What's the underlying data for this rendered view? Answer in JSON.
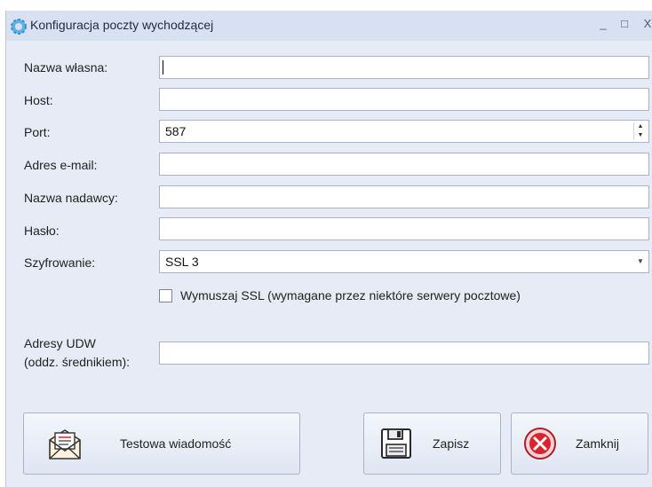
{
  "window": {
    "title": "Konfiguracja poczty wychodzącej",
    "minimize": "_",
    "maximize": "□",
    "close": "X"
  },
  "form": {
    "name_label": "Nazwa własna:",
    "name_value": "",
    "host_label": "Host:",
    "host_value": "",
    "port_label": "Port:",
    "port_value": "587",
    "email_label": "Adres e-mail:",
    "email_value": "",
    "sender_label": "Nazwa nadawcy:",
    "sender_value": "",
    "password_label": "Hasło:",
    "password_value": "",
    "encryption_label": "Szyfrowanie:",
    "encryption_value": "SSL 3",
    "force_ssl_label": "Wymuszaj SSL (wymagane przez niektóre serwery pocztowe)",
    "force_ssl_checked": false,
    "bcc_label_line1": "Adresy UDW",
    "bcc_label_line2": "(oddz. średnikiem):",
    "bcc_value": ""
  },
  "buttons": {
    "test_label": "Testowa wiadomość",
    "save_label": "Zapisz",
    "close_label": "Zamknij"
  },
  "colors": {
    "window_bg": "#e6ebf5",
    "titlebar_bg": "#d8e1f1",
    "close_icon_red": "#d9232e"
  },
  "icons": {
    "title": "gear-icon",
    "test": "envelope-icon",
    "save": "floppy-disk-icon",
    "close": "close-circle-icon"
  }
}
